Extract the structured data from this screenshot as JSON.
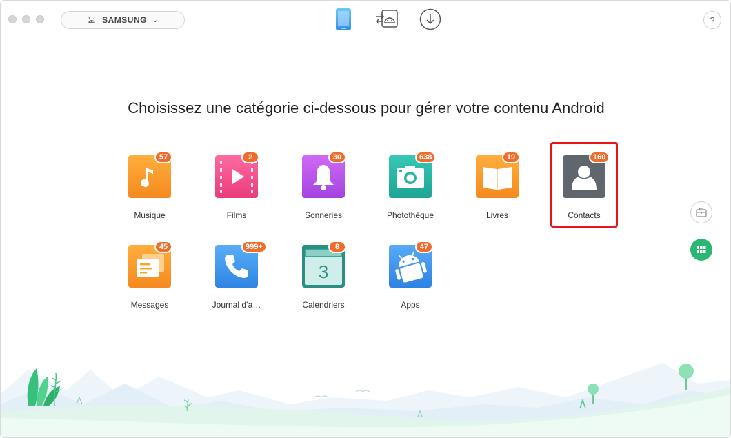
{
  "device": {
    "name": "SAMSUNG"
  },
  "toolbar": {
    "device_manager": "phone-icon",
    "android_mover": "android-transfer-icon",
    "downloader": "download-icon",
    "help_label": "?"
  },
  "main": {
    "heading": "Choisissez une catégorie ci-dessous pour gérer votre contenu Android",
    "selected": "Contacts",
    "categories": [
      {
        "label": "Musique",
        "count": "57",
        "icon": "music-icon",
        "color": "#f6a623"
      },
      {
        "label": "Films",
        "count": "2",
        "icon": "film-icon",
        "color": "#ef4f8a"
      },
      {
        "label": "Sonneries",
        "count": "30",
        "icon": "bell-icon",
        "color": "#b554e6"
      },
      {
        "label": "Photothèque",
        "count": "638",
        "icon": "camera-icon",
        "color": "#27b3a3"
      },
      {
        "label": "Livres",
        "count": "19",
        "icon": "book-icon",
        "color": "#f6a623"
      },
      {
        "label": "Contacts",
        "count": "160",
        "icon": "contact-icon",
        "color": "#5d656e"
      },
      {
        "label": "Messages",
        "count": "45",
        "icon": "message-icon",
        "color": "#f6a623"
      },
      {
        "label": "Journal d’a…",
        "count": "999+",
        "icon": "phone-call-icon",
        "color": "#3a8ff0"
      },
      {
        "label": "Calendriers",
        "count": "8",
        "icon": "calendar-icon",
        "color": "#2a9d8f"
      },
      {
        "label": "Apps",
        "count": "47",
        "icon": "android-icon",
        "color": "#3a8ff0"
      }
    ]
  },
  "colors": {
    "badge": "#ef6c2a",
    "selection": "#e8141a",
    "accent_green": "#2bb673",
    "accent_blue": "#3aa2ee"
  }
}
